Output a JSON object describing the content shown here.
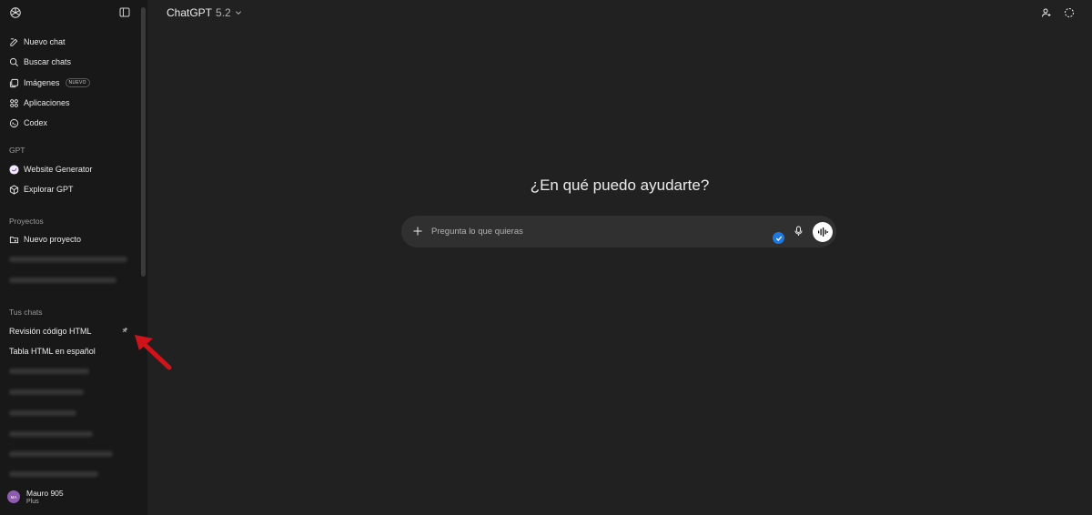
{
  "sidebar": {
    "nav": [
      {
        "label": "Nuevo chat",
        "icon": "new-chat-icon"
      },
      {
        "label": "Buscar chats",
        "icon": "search-icon"
      },
      {
        "label": "Imágenes",
        "icon": "images-icon",
        "badge": "NUEVO"
      },
      {
        "label": "Aplicaciones",
        "icon": "apps-icon"
      },
      {
        "label": "Codex",
        "icon": "codex-icon"
      }
    ],
    "gpt_section": "GPT",
    "gpts": [
      {
        "label": "Website Generator",
        "icon": "website-generator-avatar"
      },
      {
        "label": "Explorar GPT",
        "icon": "cube-icon"
      }
    ],
    "projects_section": "Proyectos",
    "new_project": "Nuevo proyecto",
    "chats_section": "Tus chats",
    "chats": [
      "Revisión código HTML",
      "Tabla HTML en español"
    ],
    "user": {
      "initials": "MA",
      "name": "Mauro 905",
      "plan": "Plus",
      "avatar_color": "#8e5bb1"
    }
  },
  "header": {
    "model": "ChatGPT",
    "version": "5.2"
  },
  "main": {
    "heading": "¿En qué puedo ayudarte?",
    "placeholder": "Pregunta lo que quieras"
  },
  "colors": {
    "background": "#212121",
    "sidebar": "#181818",
    "composer": "#303030",
    "accent_blue": "#1d78e0",
    "annotation_arrow": "#d0121b"
  }
}
